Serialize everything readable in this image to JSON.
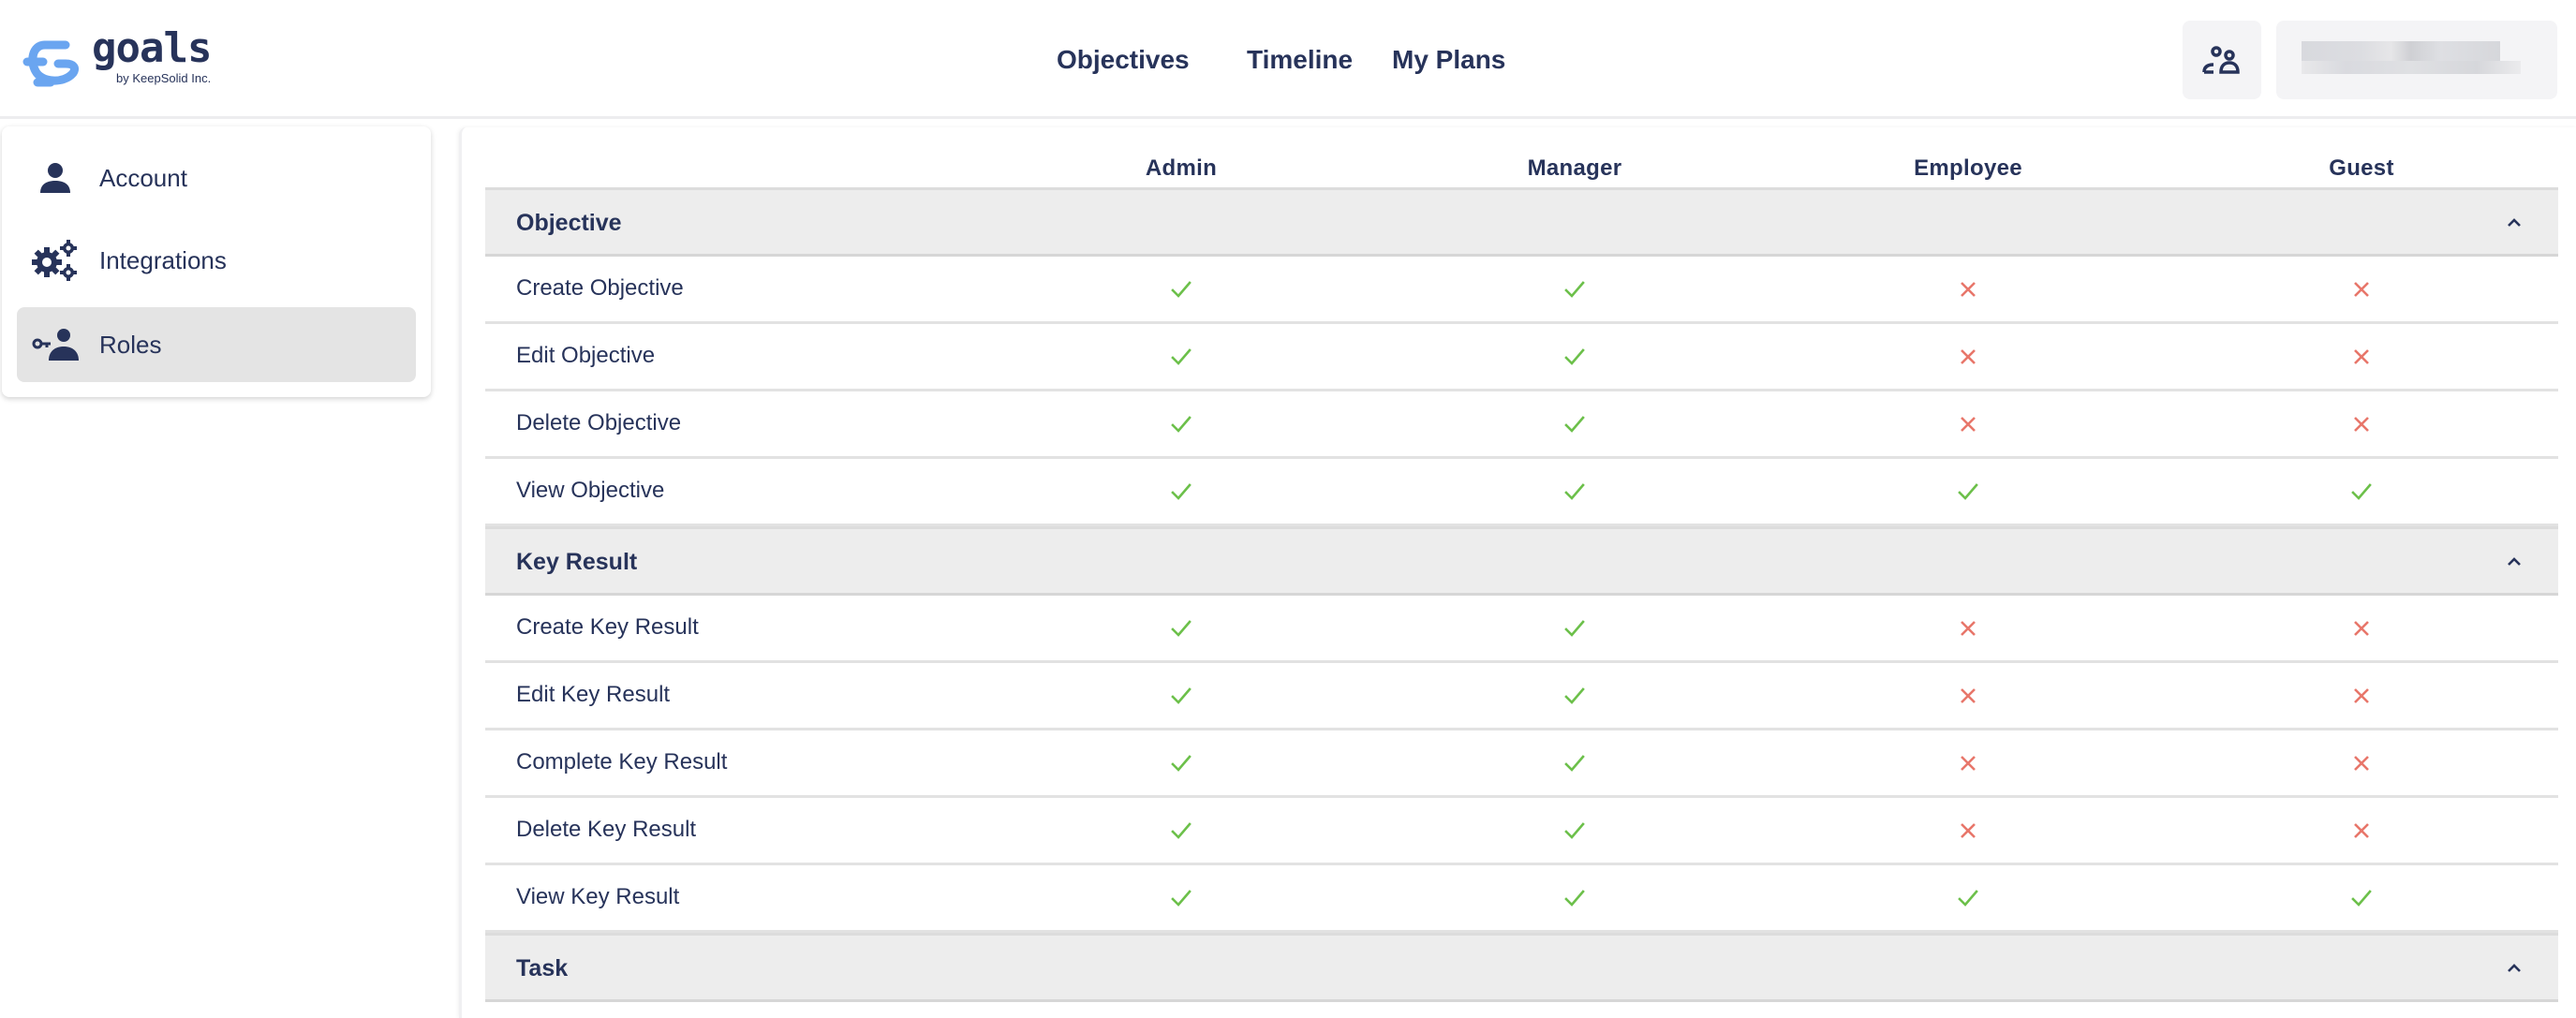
{
  "brand": {
    "name": "goals",
    "subtitle": "by KeepSolid Inc.",
    "accent_color": "#6aa5f0",
    "text_color": "#27335a"
  },
  "nav": {
    "items": [
      {
        "label": "Objectives"
      },
      {
        "label": "Timeline"
      },
      {
        "label": "My Plans"
      }
    ]
  },
  "header_actions": {
    "users_icon": "users-icon",
    "account": "redacted"
  },
  "sidebar": {
    "items": [
      {
        "label": "Account",
        "icon": "person-icon",
        "active": false
      },
      {
        "label": "Integrations",
        "icon": "gears-icon",
        "active": false
      },
      {
        "label": "Roles",
        "icon": "key-person-icon",
        "active": true
      }
    ]
  },
  "roles_table": {
    "columns": [
      "Admin",
      "Manager",
      "Employee",
      "Guest"
    ],
    "colors": {
      "allowed": "#6cc04a",
      "denied": "#e8766a"
    },
    "groups": [
      {
        "name": "Objective",
        "expanded": true,
        "rows": [
          {
            "name": "Create Objective",
            "permissions": [
              true,
              true,
              false,
              false
            ]
          },
          {
            "name": "Edit Objective",
            "permissions": [
              true,
              true,
              false,
              false
            ]
          },
          {
            "name": "Delete Objective",
            "permissions": [
              true,
              true,
              false,
              false
            ]
          },
          {
            "name": "View Objective",
            "permissions": [
              true,
              true,
              true,
              true
            ]
          }
        ]
      },
      {
        "name": "Key Result",
        "expanded": true,
        "rows": [
          {
            "name": "Create Key Result",
            "permissions": [
              true,
              true,
              false,
              false
            ]
          },
          {
            "name": "Edit Key Result",
            "permissions": [
              true,
              true,
              false,
              false
            ]
          },
          {
            "name": "Complete Key Result",
            "permissions": [
              true,
              true,
              false,
              false
            ]
          },
          {
            "name": "Delete Key Result",
            "permissions": [
              true,
              true,
              false,
              false
            ]
          },
          {
            "name": "View Key Result",
            "permissions": [
              true,
              true,
              true,
              true
            ]
          }
        ]
      },
      {
        "name": "Task",
        "expanded": true,
        "rows": []
      }
    ]
  }
}
